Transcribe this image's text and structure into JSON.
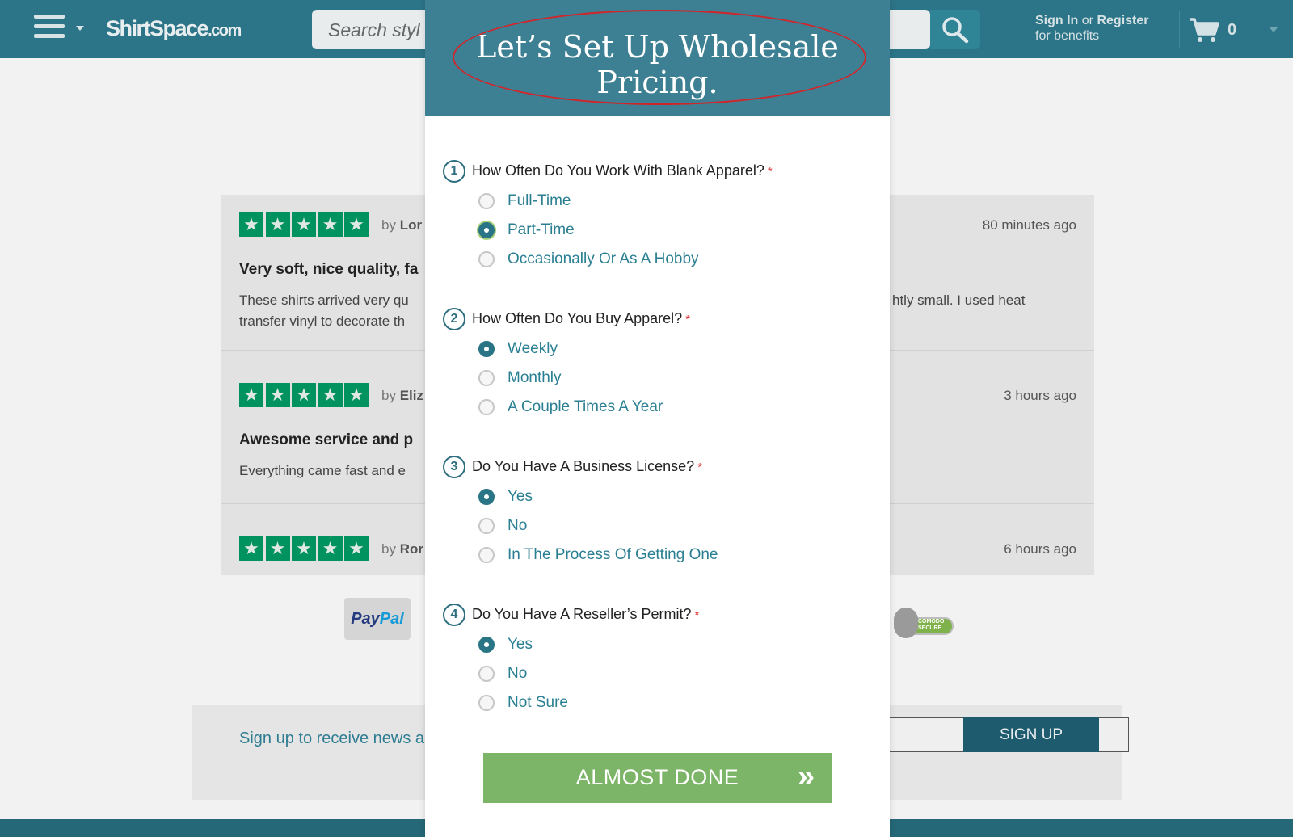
{
  "header": {
    "logo": "ShirtSpace",
    "logo_suffix": ".com",
    "search_placeholder": "Search styl",
    "signin_bold": "Sign In",
    "signin_or": "or",
    "register_bold": "Register",
    "signin_sub": "for benefits",
    "cart_count": "0"
  },
  "reviews": [
    {
      "by": "by",
      "author": "Lor",
      "time": "80 minutes ago",
      "title": "Very soft, nice quality, fa",
      "body_left_1": "These shirts arrived very qu",
      "body_left_2": "transfer vinyl to decorate th",
      "body_right": "htly small. I used heat"
    },
    {
      "by": "by",
      "author": "Eliz",
      "time": "3 hours ago",
      "title": "Awesome service and p",
      "body_left_1": "Everything came fast and e"
    },
    {
      "by": "by",
      "author": "Ror",
      "time": "6 hours ago"
    }
  ],
  "payment": {
    "paypal_a": "Pay",
    "paypal_b": "Pal",
    "comodo_1": "COMODO",
    "comodo_2": "SECURE"
  },
  "newsletter": {
    "text": "Sign up to receive news a",
    "button": "SIGN UP"
  },
  "modal": {
    "title_line1": "Let’s Set Up Wholesale",
    "title_line2": "Pricing.",
    "questions": [
      {
        "number": "1",
        "label": "How Often Do You Work With Blank Apparel?",
        "required": "*",
        "options": [
          "Full-Time",
          "Part-Time",
          "Occasionally Or As A Hobby"
        ],
        "selected": "Part-Time"
      },
      {
        "number": "2",
        "label": "How Often Do You Buy Apparel?",
        "required": "*",
        "options": [
          "Weekly",
          "Monthly",
          "A Couple Times A Year"
        ],
        "selected": "Weekly"
      },
      {
        "number": "3",
        "label": "Do You Have A Business License?",
        "required": "*",
        "options": [
          "Yes",
          "No",
          "In The Process Of Getting One"
        ],
        "selected": "Yes"
      },
      {
        "number": "4",
        "label": "Do You Have A Reseller’s Permit?",
        "required": "*",
        "options": [
          "Yes",
          "No",
          "Not Sure"
        ],
        "selected": "Yes"
      }
    ],
    "submit_label": "ALMOST DONE",
    "submit_icon": "»"
  },
  "colors": {
    "header_bg": "#2c7487",
    "modal_header_bg": "#3e8093",
    "accent_teal": "#2a7585",
    "button_green": "#7cb567",
    "star_green": "#00935f",
    "annotation_red": "#d0262b"
  },
  "icons": {
    "menu": "hamburger-menu-icon",
    "search": "search-icon",
    "cart": "shopping-cart-icon",
    "star": "star-icon",
    "submit": "double-chevron-right-icon"
  }
}
